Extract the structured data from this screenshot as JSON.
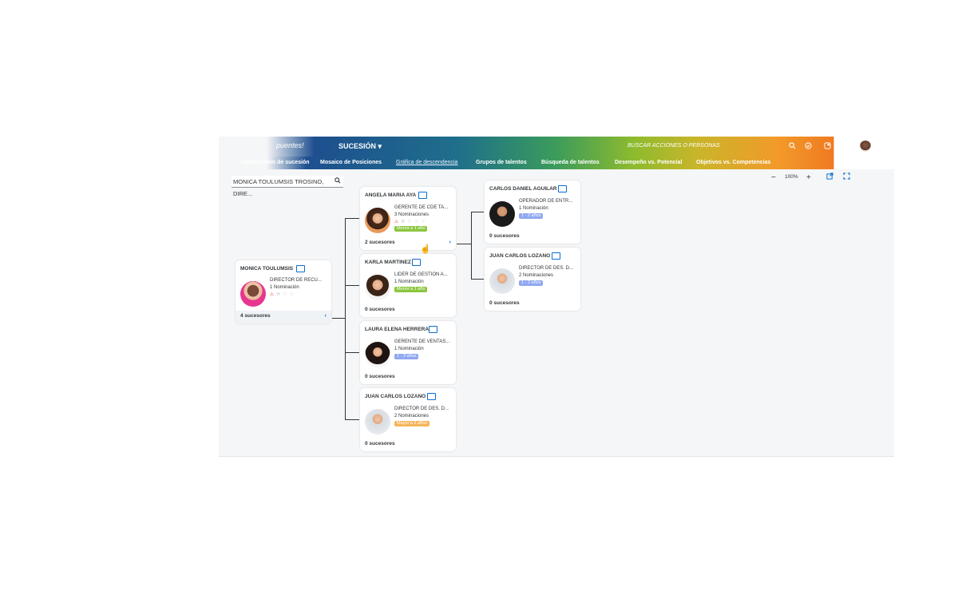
{
  "header": {
    "logo_text": "puentes!",
    "module_label": "SUCESIÓN ▾",
    "search_hint": "BUSCAR ACCIONES O PERSONAS",
    "icons": [
      "search-icon",
      "check-circle-icon",
      "notification-icon",
      "user-avatar"
    ]
  },
  "tabs": [
    {
      "label": "Planificación de sucesión"
    },
    {
      "label": "Mosaico de Posiciones"
    },
    {
      "label": "Gráfica de descendencia"
    },
    {
      "label": "Grupos de talentos"
    },
    {
      "label": "Búsqueda de talentos"
    },
    {
      "label": "Desempeño vs. Potencial"
    },
    {
      "label": "Objetivos vs. Competencias"
    }
  ],
  "toolbar": {
    "search_value": "MONICA TOULUMSIS TROSINO, DIRE...",
    "zoom_minus": "−",
    "zoom_value": "100%",
    "zoom_plus": "+"
  },
  "cards": {
    "root": {
      "name": "MONICA TOULUMSIS",
      "title": "DIRECTOR DE RECU...",
      "nominations": "1 Nominación",
      "footer": "4 sucesores"
    },
    "c1": {
      "name": "ANGELA MARIA AYA",
      "title": "GERENTE DE CDE TA...",
      "nominations": "3 Nominaciones",
      "badge": "Menor a 1 año",
      "footer": "2 sucesores"
    },
    "c2": {
      "name": "KARLA MARTINEZ",
      "title": "LIDER DE GESTION A...",
      "nominations": "1 Nominación",
      "badge": "Menor a 1 año",
      "footer": "0 sucesores"
    },
    "c3": {
      "name": "LAURA ELENA HERRERA",
      "title": "GERENTE DE VENTAS...",
      "nominations": "1 Nominación",
      "badge": "1 - 2 años",
      "footer": "0 sucesores"
    },
    "c4": {
      "name": "JUAN CARLOS LOZANO",
      "title": "DIRECTOR DE DES. D...",
      "nominations": "2 Nominaciones",
      "badge": "Mayor a 2 años",
      "footer": "0 sucesores"
    },
    "g1": {
      "name": "CARLOS DANIEL AGUILAR",
      "title": "OPERADOR DE ENTR...",
      "nominations": "1 Nominación",
      "badge": "1 - 2 años",
      "footer": "0 sucesores"
    },
    "g2": {
      "name": "JUAN CARLOS LOZANO",
      "title": "DIRECTOR DE DES. D...",
      "nominations": "2 Nominaciones",
      "badge": "1 - 2 años",
      "footer": "0 sucesores"
    }
  },
  "colors": {
    "badge_green": "#8cc63f",
    "badge_blue": "#8fa8f0",
    "badge_orange": "#f7b55a",
    "accent": "#0a6ed1"
  }
}
